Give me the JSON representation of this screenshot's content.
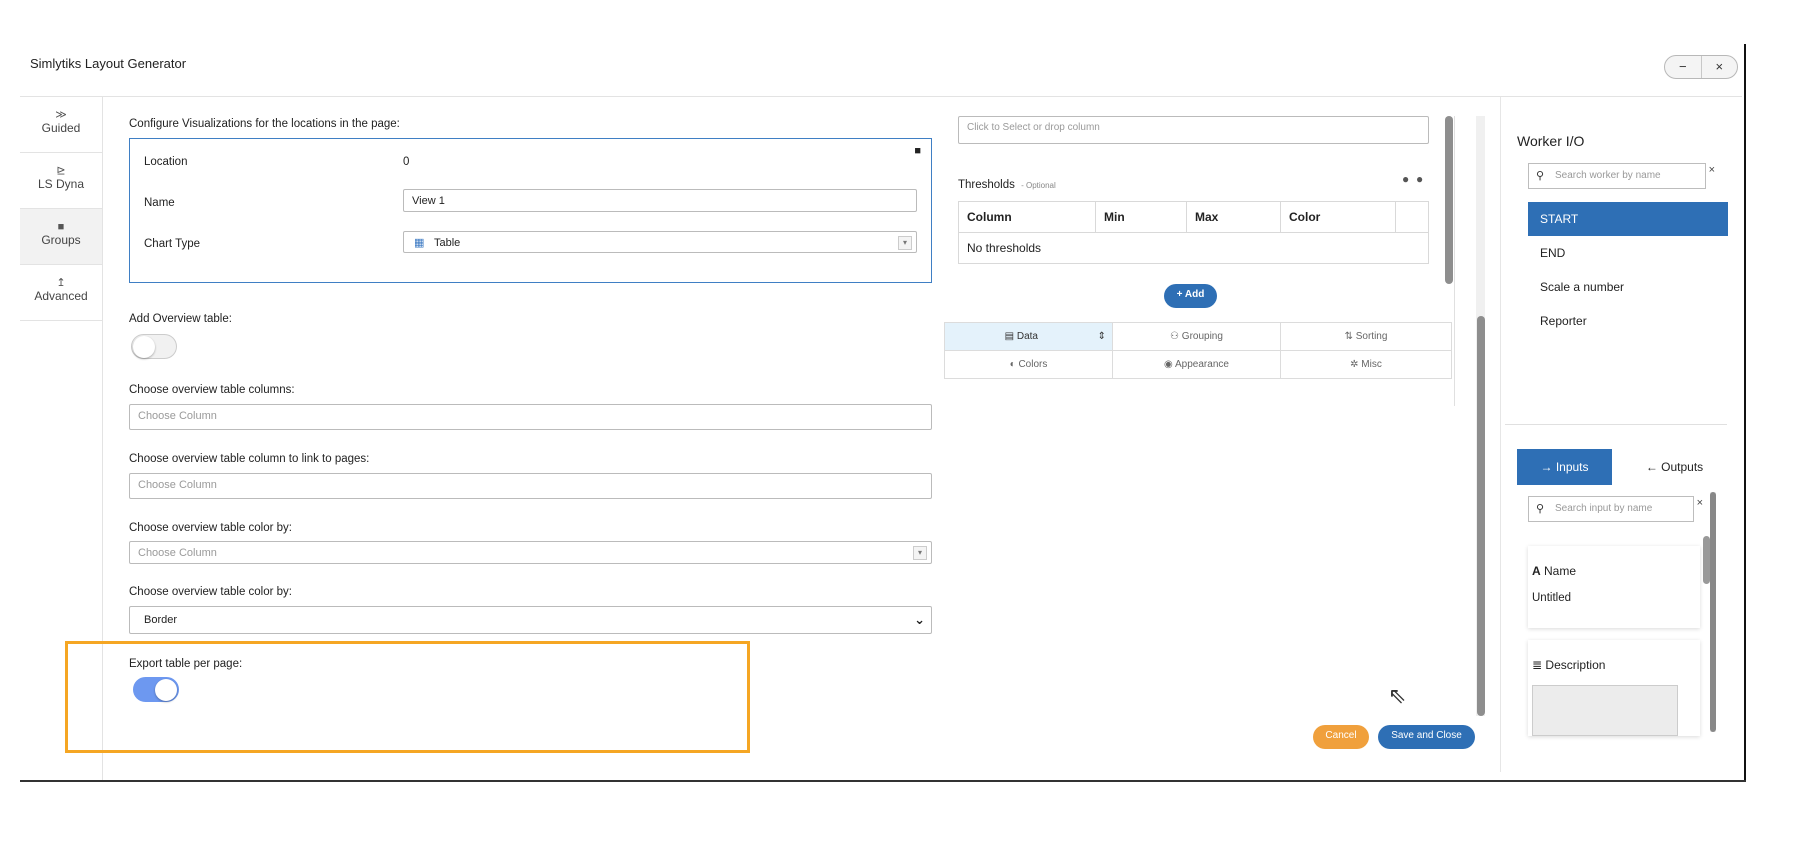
{
  "window": {
    "title": "Simlytiks Layout Generator",
    "minimize": "−",
    "close": "×"
  },
  "rail": {
    "items": [
      {
        "label": "Guided",
        "icon": "double-chevron-icon",
        "glyph": "≫"
      },
      {
        "label": "LS Dyna",
        "icon": "line-chart-icon",
        "glyph": "⊵"
      },
      {
        "label": "Groups",
        "icon": "stack-icon",
        "glyph": "■"
      },
      {
        "label": "Advanced",
        "icon": "arrow-up-icon",
        "glyph": "↥"
      }
    ]
  },
  "config": {
    "heading": "Configure Visualizations for the locations in the page:",
    "location_label": "Location",
    "location_value": "0",
    "name_label": "Name",
    "name_value": "View 1",
    "chart_type_label": "Chart Type",
    "chart_type_value": "Table"
  },
  "overview": {
    "add_label": "Add Overview table:",
    "add_enabled": false,
    "columns_label": "Choose overview table columns:",
    "columns_placeholder": "Choose Column",
    "link_label": "Choose overview table column to link to pages:",
    "link_placeholder": "Choose Column",
    "color_label": "Choose overview table color by:",
    "color_placeholder": "Choose Column",
    "color2_label": "Choose overview table color by:",
    "color2_value": "Border",
    "export_label": "Export table per page:",
    "export_enabled": true
  },
  "middle": {
    "drop_placeholder": "Click to Select or drop column",
    "thresholds_title": "Thresholds",
    "thresholds_optional": "- Optional",
    "columns": [
      "Column",
      "Min",
      "Max",
      "Color"
    ],
    "empty_text": "No thresholds",
    "add_button": "+ Add",
    "tabs_row1": [
      {
        "label": "Data",
        "glyph": "▤"
      },
      {
        "label": "Grouping",
        "glyph": "⚇"
      },
      {
        "label": "Sorting",
        "glyph": "⇅"
      }
    ],
    "tabs_row2": [
      {
        "label": "Colors",
        "glyph": "◐"
      },
      {
        "label": "Appearance",
        "glyph": "◉"
      },
      {
        "label": "Misc",
        "glyph": "✲"
      }
    ],
    "cancel_button": "Cancel",
    "save_button": "Save and Close"
  },
  "worker": {
    "title": "Worker I/O",
    "search_placeholder": "Search worker by name",
    "items": [
      "START",
      "END",
      "Scale a number",
      "Reporter"
    ],
    "inputs_tab": "→ Inputs",
    "outputs_tab": "← Outputs",
    "input_search_placeholder": "Search input by name",
    "name_field_label": "Name",
    "name_field_value": "Untitled",
    "description_label": "Description"
  },
  "colors": {
    "accent": "#2e6fb5",
    "highlight": "#f5a623",
    "cancel": "#f0a03c",
    "toggle_on": "#6d98f0"
  }
}
